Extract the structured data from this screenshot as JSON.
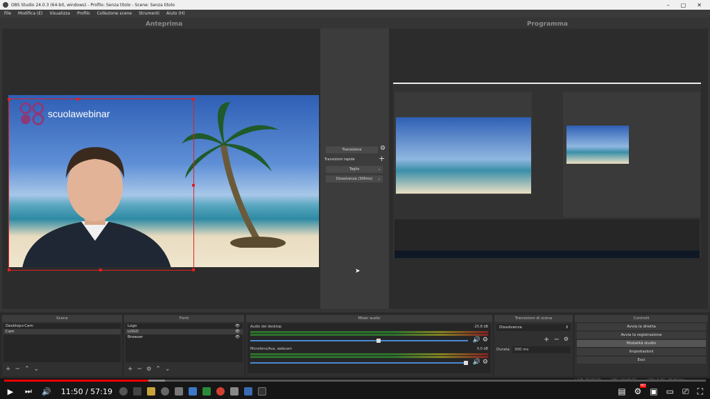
{
  "window": {
    "title": "OBS Studio 24.0.3 (64-bit, windows) - Profilo: Senza titolo - Scene: Senza titolo",
    "min": "–",
    "max": "□",
    "close": "✕"
  },
  "menu": [
    "File",
    "Modifica (E)",
    "Visualizza",
    "Profilo",
    "Collezione scene",
    "Strumenti",
    "Aiuto (H)"
  ],
  "preview": {
    "title": "Anteprima",
    "logo_text": "scuolawebinar"
  },
  "program": {
    "title": "Programma"
  },
  "transitions_center": {
    "transition_btn": "Transizione",
    "quick_label": "Transizioni rapide",
    "cut": "Taglio",
    "fade": "Dissolvenza (300ms)"
  },
  "docks": {
    "scenes": {
      "title": "Scene",
      "items": [
        "Desktop+Cam",
        "Cam"
      ],
      "selected": 1
    },
    "sources": {
      "title": "Fonti",
      "items": [
        "Logo",
        "LOGO",
        "Browser"
      ]
    },
    "mixer": {
      "title": "Mixer audio",
      "tracks": [
        {
          "name": "Audio del desktop",
          "db": "-25.8 dB",
          "level": 0.6
        },
        {
          "name": "Microfono/Aux, webcam",
          "db": "0.0 dB",
          "level": 1.0
        }
      ]
    },
    "scene_transitions": {
      "title": "Transizioni di scena",
      "selected": "Dissolvenza",
      "duration_label": "Durata",
      "duration_value": "300 ms"
    },
    "controls": {
      "title": "Controlli",
      "buttons": [
        "Avvia la diretta",
        "Avvia la registrazione",
        "Modalità studio",
        "Impostazioni",
        "Esci"
      ],
      "active_index": 2
    }
  },
  "status_bar": {
    "live": "LIVE: 00:00:00",
    "rec": "REC: 00:00:00",
    "cpu": "CPU: 5.0%, 30.00 fps"
  },
  "player": {
    "current_time": "11:50",
    "duration": "57:19",
    "time_sep": " / ",
    "progress_fraction": 0.206,
    "icons": [
      "play-icon",
      "next-icon",
      "volume-icon",
      "settings-icon",
      "miniplayer-icon",
      "theater-icon",
      "cast-icon",
      "fullscreen-icon"
    ],
    "hd_badge": "HD"
  },
  "colors": {
    "accent_red": "#e02020",
    "player_red": "#ee0000",
    "obs_bg": "#2b2b2b"
  }
}
